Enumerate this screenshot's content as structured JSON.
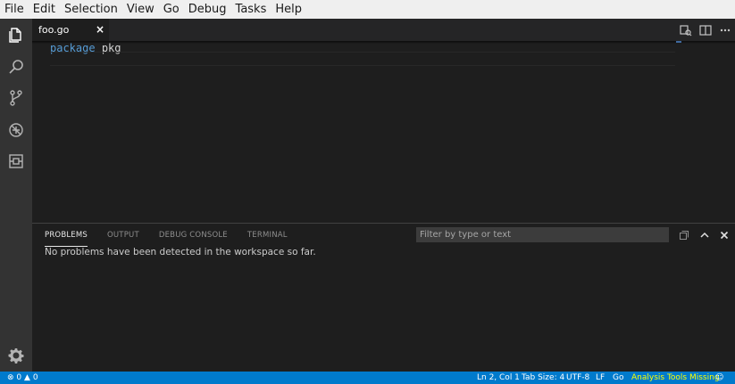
{
  "menu": [
    "File",
    "Edit",
    "Selection",
    "View",
    "Go",
    "Debug",
    "Tasks",
    "Help"
  ],
  "activity_bar": {
    "icons": [
      "explorer-icon",
      "search-icon",
      "source-control-icon",
      "debug-icon",
      "extensions-icon"
    ],
    "bottom_icon": "gear-icon"
  },
  "editor": {
    "tab": {
      "label": "foo.go",
      "close": "×"
    },
    "actions": [
      "open-preview-icon",
      "split-editor-icon",
      "more-actions-icon"
    ],
    "lines": [
      {
        "keyword": "package",
        "identifier": "pkg"
      }
    ]
  },
  "panel": {
    "tabs": [
      "PROBLEMS",
      "OUTPUT",
      "DEBUG CONSOLE",
      "TERMINAL"
    ],
    "active_tab": "PROBLEMS",
    "filter_placeholder": "Filter by type or text",
    "message": "No problems have been detected in the workspace so far.",
    "actions": [
      "collapse-all-icon",
      "maximize-panel-icon",
      "close-panel-icon"
    ]
  },
  "statusbar": {
    "errors": "0",
    "warnings": "0",
    "position": "Ln 2, Col 1",
    "tab_size": "Tab Size: 4",
    "encoding": "UTF-8",
    "eol": "LF",
    "language": "Go",
    "analysis": "Analysis Tools Missing",
    "colors": {
      "background": "#007acc",
      "analysis": "#ffff00"
    }
  },
  "colors": {
    "editor_bg": "#1e1e1e",
    "activity_bar_bg": "#333333",
    "keyword": "#569cd6"
  }
}
